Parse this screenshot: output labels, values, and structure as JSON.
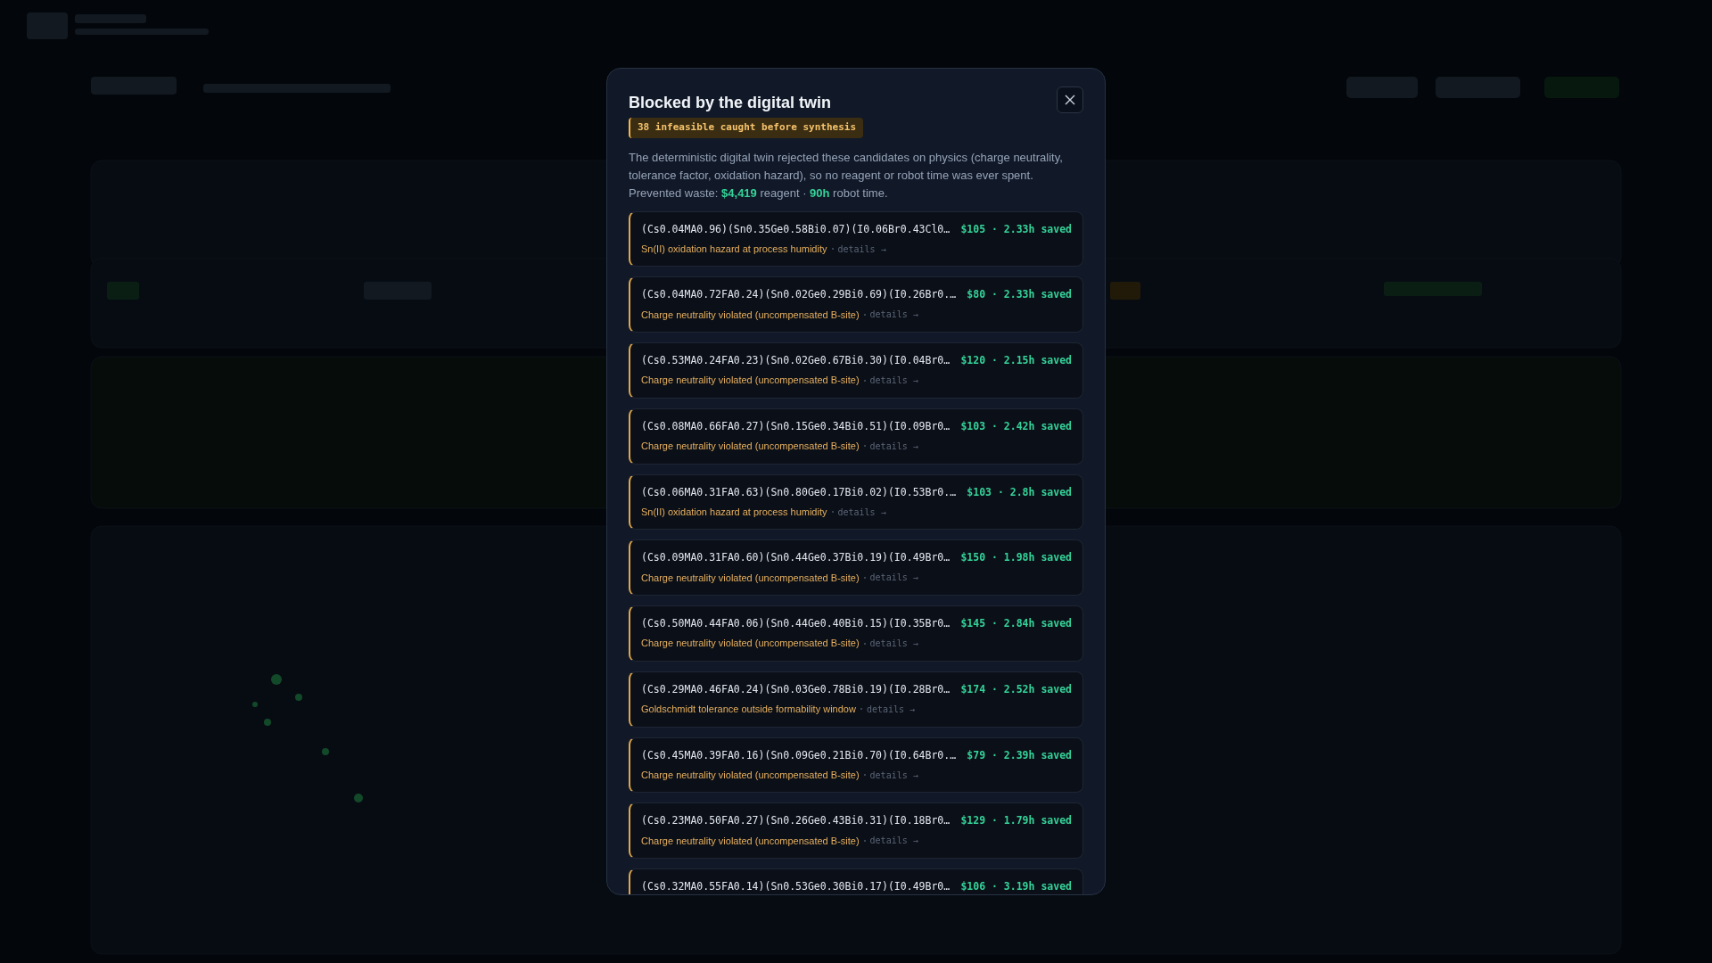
{
  "modal": {
    "title": "Blocked by the digital twin",
    "badge": "38 infeasible caught before synthesis",
    "description": "The deterministic digital twin rejected these candidates on physics (charge neutrality, tolerance factor, oxidation hazard), so no reagent or robot time was ever spent.",
    "waste": "Prevented waste: **$4,419** reagent · **90h** robot time.",
    "candidates": [
      {
        "formula": "(Cs0.04MA0.96)(Sn0.35Ge0.58Bi0.07)(I0.06Br0.43Cl0…",
        "saving": "$105 · 2.33h saved",
        "reason": "Sn(II) oxidation hazard at process humidity",
        "link": "details →"
      },
      {
        "formula": "(Cs0.04MA0.72FA0.24)(Sn0.02Ge0.29Bi0.69)(I0.26Br0.…",
        "saving": "$80 · 2.33h saved",
        "reason": "Charge neutrality violated (uncompensated B-site)",
        "link": "details →"
      },
      {
        "formula": "(Cs0.53MA0.24FA0.23)(Sn0.02Ge0.67Bi0.30)(I0.04Br0…",
        "saving": "$120 · 2.15h saved",
        "reason": "Charge neutrality violated (uncompensated B-site)",
        "link": "details →"
      },
      {
        "formula": "(Cs0.08MA0.66FA0.27)(Sn0.15Ge0.34Bi0.51)(I0.09Br0…",
        "saving": "$103 · 2.42h saved",
        "reason": "Charge neutrality violated (uncompensated B-site)",
        "link": "details →"
      },
      {
        "formula": "(Cs0.06MA0.31FA0.63)(Sn0.80Ge0.17Bi0.02)(I0.53Br0.…",
        "saving": "$103 · 2.8h saved",
        "reason": "Sn(II) oxidation hazard at process humidity",
        "link": "details →"
      },
      {
        "formula": "(Cs0.09MA0.31FA0.60)(Sn0.44Ge0.37Bi0.19)(I0.49Br0…",
        "saving": "$150 · 1.98h saved",
        "reason": "Charge neutrality violated (uncompensated B-site)",
        "link": "details →"
      },
      {
        "formula": "(Cs0.50MA0.44FA0.06)(Sn0.44Ge0.40Bi0.15)(I0.35Br0…",
        "saving": "$145 · 2.84h saved",
        "reason": "Charge neutrality violated (uncompensated B-site)",
        "link": "details →"
      },
      {
        "formula": "(Cs0.29MA0.46FA0.24)(Sn0.03Ge0.78Bi0.19)(I0.28Br0…",
        "saving": "$174 · 2.52h saved",
        "reason": "Goldschmidt tolerance outside formability window",
        "link": "details →"
      },
      {
        "formula": "(Cs0.45MA0.39FA0.16)(Sn0.09Ge0.21Bi0.70)(I0.64Br0.…",
        "saving": "$79 · 2.39h saved",
        "reason": "Charge neutrality violated (uncompensated B-site)",
        "link": "details →"
      },
      {
        "formula": "(Cs0.23MA0.50FA0.27)(Sn0.26Ge0.43Bi0.31)(I0.18Br0…",
        "saving": "$129 · 1.79h saved",
        "reason": "Charge neutrality violated (uncompensated B-site)",
        "link": "details →"
      },
      {
        "formula": "(Cs0.32MA0.55FA0.14)(Sn0.53Ge0.30Bi0.17)(I0.49Br0…",
        "saving": "$106 · 3.19h saved"
      }
    ]
  }
}
